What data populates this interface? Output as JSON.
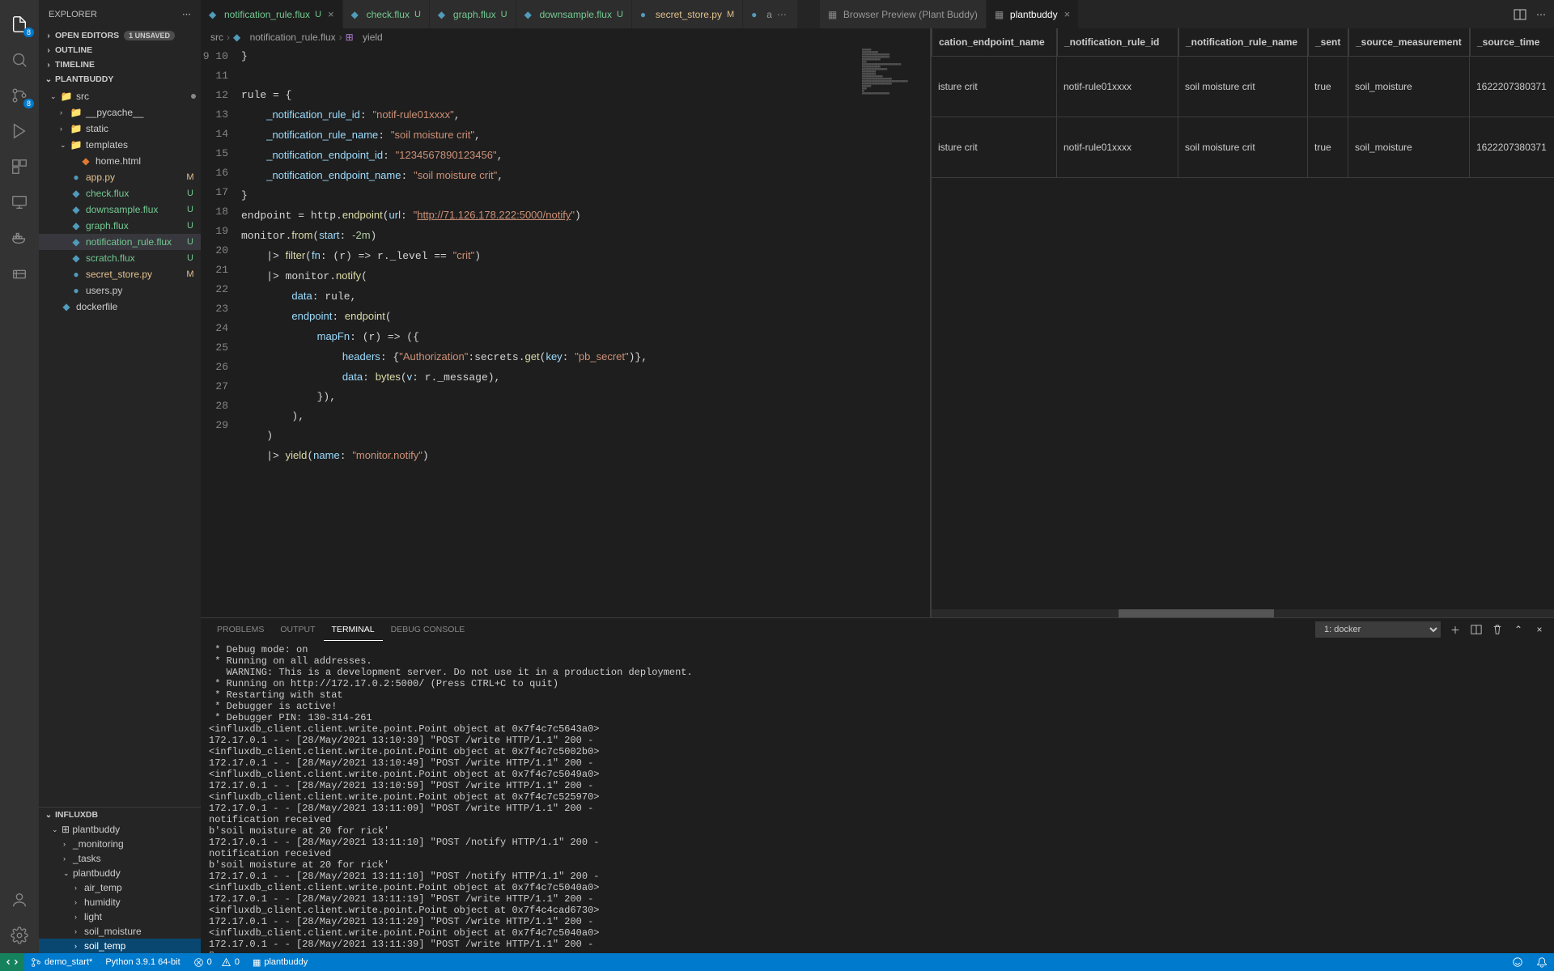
{
  "sidebar": {
    "title": "EXPLORER",
    "openEditors": {
      "label": "OPEN EDITORS",
      "unsaved": "1 UNSAVED"
    },
    "outline": "OUTLINE",
    "timeline": "TIMELINE",
    "project": "PLANTBUDDY",
    "srcFolder": "src",
    "items": {
      "pycache": "__pycache__",
      "static": "static",
      "templates": "templates",
      "home": "home.html",
      "app": "app.py",
      "check": "check.flux",
      "downsample": "downsample.flux",
      "graph": "graph.flux",
      "notif": "notification_rule.flux",
      "scratch": "scratch.flux",
      "secret": "secret_store.py",
      "users": "users.py",
      "dockerfile": "dockerfile"
    },
    "influx": {
      "title": "INFLUXDB",
      "org": "plantbuddy",
      "buckets": {
        "monitoring": "_monitoring",
        "tasks": "_tasks",
        "plantbuddy": "plantbuddy",
        "air_temp": "air_temp",
        "humidity": "humidity",
        "light": "light",
        "soil_moisture": "soil_moisture",
        "soil_temp": "soil_temp"
      }
    }
  },
  "activity": {
    "badge": "8"
  },
  "tabs": {
    "notif": {
      "label": "notification_rule.flux",
      "status": "U"
    },
    "check": {
      "label": "check.flux",
      "status": "U"
    },
    "graph": {
      "label": "graph.flux",
      "status": "U"
    },
    "downsample": {
      "label": "downsample.flux",
      "status": "U"
    },
    "secret": {
      "label": "secret_store.py",
      "status": "M"
    },
    "a": {
      "label": "a"
    },
    "browser": {
      "label": "Browser Preview (Plant Buddy)"
    },
    "plantbuddy": {
      "label": "plantbuddy"
    }
  },
  "breadcrumb": {
    "p0": "src",
    "p1": "notification_rule.flux",
    "p2": "yield"
  },
  "code_lines_start": 9,
  "preview": {
    "cols": [
      "cation_endpoint_name",
      "_notification_rule_id",
      "_notification_rule_name",
      "_sent",
      "_source_measurement",
      "_source_time"
    ],
    "rows": [
      [
        "isture crit",
        "notif-rule01xxxx",
        "soil moisture crit",
        "true",
        "soil_moisture",
        "1622207380371"
      ],
      [
        "isture crit",
        "notif-rule01xxxx",
        "soil moisture crit",
        "true",
        "soil_moisture",
        "1622207380371"
      ]
    ]
  },
  "panel": {
    "tabs": {
      "problems": "PROBLEMS",
      "output": "OUTPUT",
      "terminal": "TERMINAL",
      "debug": "DEBUG CONSOLE"
    },
    "shell": "1: docker"
  },
  "terminal_text": " * Debug mode: on\n * Running on all addresses.\n   WARNING: This is a development server. Do not use it in a production deployment.\n * Running on http://172.17.0.2:5000/ (Press CTRL+C to quit)\n * Restarting with stat\n * Debugger is active!\n * Debugger PIN: 130-314-261\n<influxdb_client.client.write.point.Point object at 0x7f4c7c5643a0>\n172.17.0.1 - - [28/May/2021 13:10:39] \"POST /write HTTP/1.1\" 200 -\n<influxdb_client.client.write.point.Point object at 0x7f4c7c5002b0>\n172.17.0.1 - - [28/May/2021 13:10:49] \"POST /write HTTP/1.1\" 200 -\n<influxdb_client.client.write.point.Point object at 0x7f4c7c5049a0>\n172.17.0.1 - - [28/May/2021 13:10:59] \"POST /write HTTP/1.1\" 200 -\n<influxdb_client.client.write.point.Point object at 0x7f4c7c525970>\n172.17.0.1 - - [28/May/2021 13:11:09] \"POST /write HTTP/1.1\" 200 -\nnotification received\nb'soil moisture at 20 for rick'\n172.17.0.1 - - [28/May/2021 13:11:10] \"POST /notify HTTP/1.1\" 200 -\nnotification received\nb'soil moisture at 20 for rick'\n172.17.0.1 - - [28/May/2021 13:11:10] \"POST /notify HTTP/1.1\" 200 -\n<influxdb_client.client.write.point.Point object at 0x7f4c7c5040a0>\n172.17.0.1 - - [28/May/2021 13:11:19] \"POST /write HTTP/1.1\" 200 -\n<influxdb_client.client.write.point.Point object at 0x7f4c4cad6730>\n172.17.0.1 - - [28/May/2021 13:11:29] \"POST /write HTTP/1.1\" 200 -\n<influxdb_client.client.write.point.Point object at 0x7f4c7c5040a0>\n172.17.0.1 - - [28/May/2021 13:11:39] \"POST /write HTTP/1.1\" 200 -\n▯",
  "status": {
    "branch": "demo_start*",
    "python": "Python 3.9.1 64-bit",
    "errors": "0",
    "warnings": "0",
    "plantbuddy": "plantbuddy"
  }
}
